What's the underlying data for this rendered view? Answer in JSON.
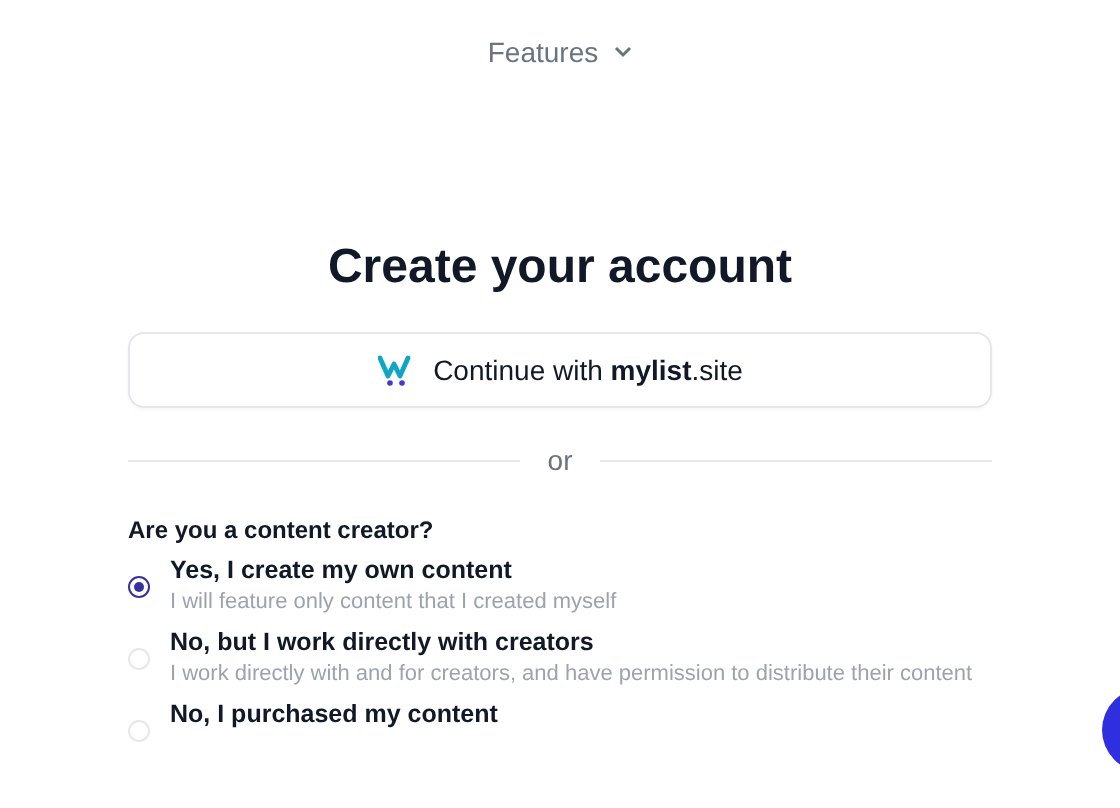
{
  "nav": {
    "label": "Features"
  },
  "title": "Create your account",
  "sso_button": {
    "prefix": "Continue with ",
    "brand": "mylist",
    "suffix": ".site"
  },
  "divider": "or",
  "question": "Are you a content creator?",
  "options": [
    {
      "label": "Yes, I create my own content",
      "description": "I will feature only content that I created myself",
      "selected": true
    },
    {
      "label": "No, but I work directly with creators",
      "description": "I work directly with and for creators, and have permission to distribute their content",
      "selected": false
    },
    {
      "label": "No, I purchased my content",
      "selected": false
    }
  ]
}
